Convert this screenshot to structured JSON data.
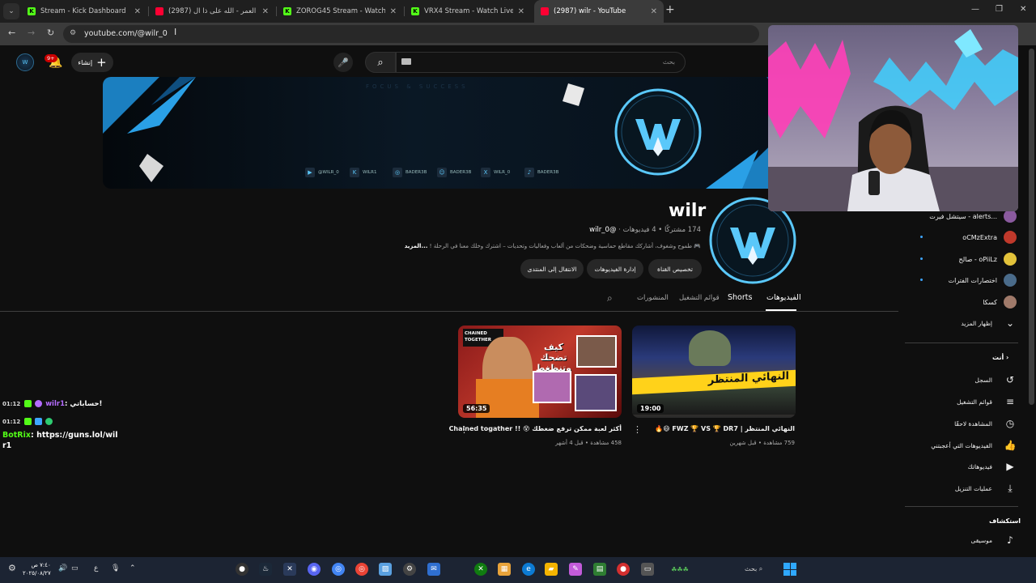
{
  "browser": {
    "tabs": [
      {
        "title": "Stream - Kick Dashboard",
        "favicon": "kick-icon"
      },
      {
        "title": "(2987) عمر العمر - الله على ذا ال...",
        "favicon": "youtube-icon"
      },
      {
        "title": "ZOROG45 Stream - Watch Live",
        "favicon": "kick-icon"
      },
      {
        "title": "VRX4 Stream - Watch Live on K",
        "favicon": "kick-icon"
      },
      {
        "title": "(2987) wilr - YouTube",
        "favicon": "youtube-icon",
        "active": true
      }
    ],
    "url": "youtube.com/@wilr_0"
  },
  "header": {
    "notification_count": "9+",
    "create_label": "إنشاء",
    "search_placeholder": "بحث"
  },
  "banner": {
    "tagline": "FOCUS & SUCCESS",
    "socials": [
      {
        "icon": "youtube-icon",
        "glyph": "▶",
        "label": "@WILR_0"
      },
      {
        "icon": "kick-icon",
        "glyph": "K",
        "label": "WILR1"
      },
      {
        "icon": "instagram-icon",
        "glyph": "◎",
        "label": "BADER3B"
      },
      {
        "icon": "snapchat-icon",
        "glyph": "☺",
        "label": "BADER3B"
      },
      {
        "icon": "x-icon",
        "glyph": "X",
        "label": "WILR_0"
      },
      {
        "icon": "tiktok-icon",
        "glyph": "♪",
        "label": "BADER3B"
      }
    ]
  },
  "channel": {
    "name": "wilr",
    "handle": "@wilr_0",
    "stats": "174 مشتركًا • 4 فيديوهات",
    "description": "🎮 طموح وشغوف، أشاركك مقاطع حماسية وضحكات من ألعاب وفعاليات وتحديات – اشترك وخلك معنا في الرحلة !",
    "more_label": "...المزيد",
    "buttons": {
      "customize": "تخصيص القناة",
      "manage": "إدارة الفيديوهات",
      "studio": "الانتقال إلى المنتدى"
    }
  },
  "tabs": [
    "الفيديوهات",
    "Shorts",
    "قوائم التشغيل",
    "المنشورات"
  ],
  "videos": [
    {
      "title": "النهائي المنتظر | FWZ 🏆 VS 🏆 DR7 😄🔥",
      "meta": "759 مشاهدة • قبل شهرين",
      "duration": "19:00",
      "thumb_text": "النهائي المنتظر"
    },
    {
      "title": "أكثر لعبة ممكن ترفع ضغطك 😵 !! Chained togather",
      "meta": "458 مشاهدة • قبل 4 أشهر",
      "duration": "56:35",
      "thumb_text": "كيف تضحك وتنظغط !",
      "thumb_badge": "CHAINED TOGETHER"
    }
  ],
  "sidebar": {
    "subscriptions": [
      {
        "label": "سيتشل فيرت - alerts...",
        "color": "#8a5a9e"
      },
      {
        "label": "oCMzExtra",
        "color": "#c0392b"
      },
      {
        "label": "صالح - oPiiLz",
        "color": "#e2c23a"
      },
      {
        "label": "اختصارات الفترات",
        "color": "#4a6b8a"
      },
      {
        "label": "كسكا",
        "color": "#a07a6a"
      }
    ],
    "show_more": "إظهار المزيد",
    "you_heading": "أنت",
    "you_items": [
      {
        "label": "السجل",
        "icon": "history-icon",
        "glyph": "↺"
      },
      {
        "label": "قوائم التشغيل",
        "icon": "playlist-icon",
        "glyph": "≡"
      },
      {
        "label": "المشاهدة لاحقًا",
        "icon": "clock-icon",
        "glyph": "◷"
      },
      {
        "label": "الفيديوهات التي أعجبتني",
        "icon": "like-icon",
        "glyph": "👍"
      },
      {
        "label": "فيديوهاتك",
        "icon": "your-videos-icon",
        "glyph": "▶"
      },
      {
        "label": "عمليات التنزيل",
        "icon": "download-icon",
        "glyph": "⤓"
      }
    ],
    "explore_heading": "استكشاف",
    "explore_items": [
      {
        "label": "موسيقى",
        "icon": "music-icon",
        "glyph": "♪"
      }
    ]
  },
  "chat": [
    {
      "time": "01:12",
      "user": "wilr1",
      "message": "حساباتي!",
      "user_color": "#b46cff"
    },
    {
      "time": "01:12",
      "user": "BotRix",
      "message": "https://guns.lol/wilr1",
      "user_color": "#53fc18"
    }
  ],
  "taskbar": {
    "time": "٧:٤٠ ص",
    "date": "٢٠٢٥/٠٨/٢٧",
    "lang": "ع",
    "search_label": "بحث"
  },
  "colors": {
    "background": "#0f0f0f",
    "accent_blue": "#3ea6ff",
    "kick_green": "#53fc18",
    "youtube_red": "#ff0033"
  }
}
